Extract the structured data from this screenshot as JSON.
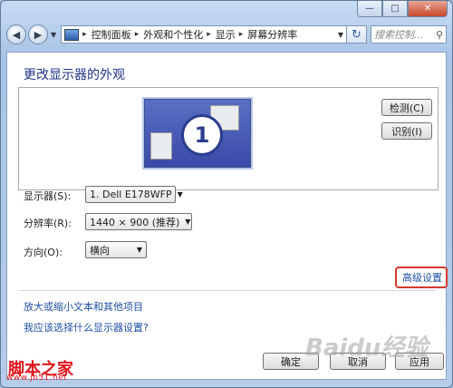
{
  "window": {
    "caption_buttons": {
      "minimize_icon": "minimize-icon",
      "maximize_icon": "maximize-icon",
      "close_icon": "close-icon"
    }
  },
  "navbar": {
    "back_icon": "back-arrow-icon",
    "forward_icon": "forward-arrow-icon",
    "breadcrumbs": [
      "控制面板",
      "外观和个性化",
      "显示",
      "屏幕分辨率"
    ],
    "search_placeholder": "搜索控制...",
    "refresh_icon": "refresh-icon",
    "search_icon": "search-icon"
  },
  "page": {
    "title": "更改显示器的外观",
    "monitor_number": "1",
    "detect_button": "检测(C)",
    "identify_button": "识别(I)",
    "display_label": "显示器(S):",
    "display_value": "1. Dell E178WFP",
    "resolution_label": "分辨率(R):",
    "resolution_value": "1440 × 900 (推荐)",
    "orientation_label": "方向(O):",
    "orientation_value": "横向",
    "advanced_link": "高级设置",
    "link_text_size": "放大或缩小文本和其他项目",
    "link_which_settings": "我应该选择什么显示器设置?",
    "ok_button": "确定",
    "cancel_button": "取消",
    "apply_button": "应用"
  },
  "watermarks": {
    "site_name": "脚本之家",
    "site_url": "www.jb51.net",
    "baidu": "Baidu经验"
  },
  "colors": {
    "highlight_box": "#d6392b",
    "link": "#1e50a2",
    "title": "#1e3287",
    "watermark": "#e0141b"
  }
}
